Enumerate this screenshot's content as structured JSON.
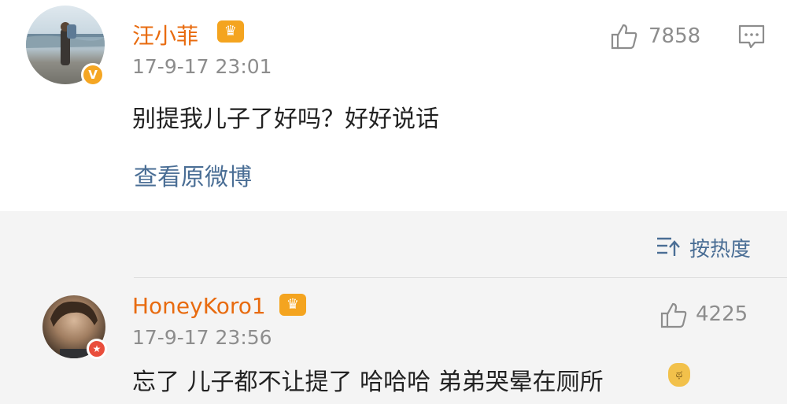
{
  "comments": [
    {
      "username": "汪小菲",
      "timestamp": "17-9-17 23:01",
      "text": "别提我儿子了好吗？好好说话",
      "likes": "7858",
      "action_link": "查看原微博"
    },
    {
      "username": "HoneyKoro1",
      "timestamp": "17-9-17 23:56",
      "text": "忘了 儿子都不让提了 哈哈哈 弟弟哭晕在厕所",
      "likes": "4225"
    }
  ],
  "sort_label": "按热度",
  "icons": {
    "verified_badge": "v-badge-icon",
    "crown": "crown-icon",
    "like": "thumbs-up-icon",
    "comment": "comment-icon",
    "sort": "sort-icon",
    "emoji": "crying-emoji-icon"
  },
  "colors": {
    "username": "#e86b0f",
    "link": "#4a6e95",
    "meta": "#8d8d8d",
    "background": "#f4f4f4"
  }
}
